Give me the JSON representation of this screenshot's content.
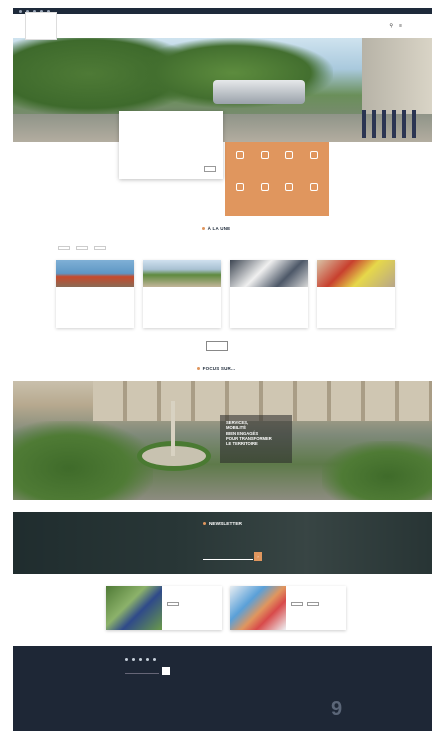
{
  "topbar": {
    "left": "",
    "links": [
      "",
      ""
    ]
  },
  "header": {
    "logo_line1": "",
    "logo_line2": "",
    "menu": [
      "",
      "",
      "",
      "",
      ""
    ]
  },
  "hero_card": {
    "title": "",
    "text": "",
    "link": "",
    "button": ""
  },
  "quick_access": [
    {
      "label": ""
    },
    {
      "label": ""
    },
    {
      "label": ""
    },
    {
      "label": ""
    },
    {
      "label": ""
    },
    {
      "label": ""
    },
    {
      "label": ""
    },
    {
      "label": ""
    }
  ],
  "une": {
    "title": "À LA UNE",
    "tabs": [
      "",
      "",
      ""
    ],
    "cards": [
      {
        "tag": "",
        "title": "",
        "text": ""
      },
      {
        "tag": "",
        "title": "",
        "text": ""
      },
      {
        "tag": "",
        "title": "",
        "text": ""
      },
      {
        "tag": "",
        "title": "",
        "text": ""
      }
    ],
    "more_label": ""
  },
  "focus": {
    "title": "FOCUS SUR...",
    "lines": [
      "SERVICES,",
      "MOBILITÉ",
      "BIEN ENGAGÉS",
      "POUR TRANSFORMER",
      "LE TERRITOIRE"
    ],
    "link": ""
  },
  "newsletter": {
    "title": "NEWSLETTER",
    "text": "",
    "placeholder": "",
    "go": "›"
  },
  "promos": [
    {
      "title": "",
      "text": "",
      "buttons": [
        ""
      ]
    },
    {
      "title": "",
      "text": "",
      "buttons": [
        "",
        ""
      ]
    }
  ],
  "footer": {
    "logo": "",
    "about": "",
    "cols": [
      {
        "heading": "",
        "items": []
      },
      {
        "heading": "",
        "items": [
          "",
          "",
          ""
        ]
      },
      {
        "heading": "",
        "items": [
          "",
          "",
          "",
          "",
          ""
        ]
      }
    ],
    "badge_number": "9",
    "badge_text": ""
  },
  "colors": {
    "accent": "#e0965e",
    "navy": "#1e2a3a",
    "footer": "#1e2736"
  }
}
